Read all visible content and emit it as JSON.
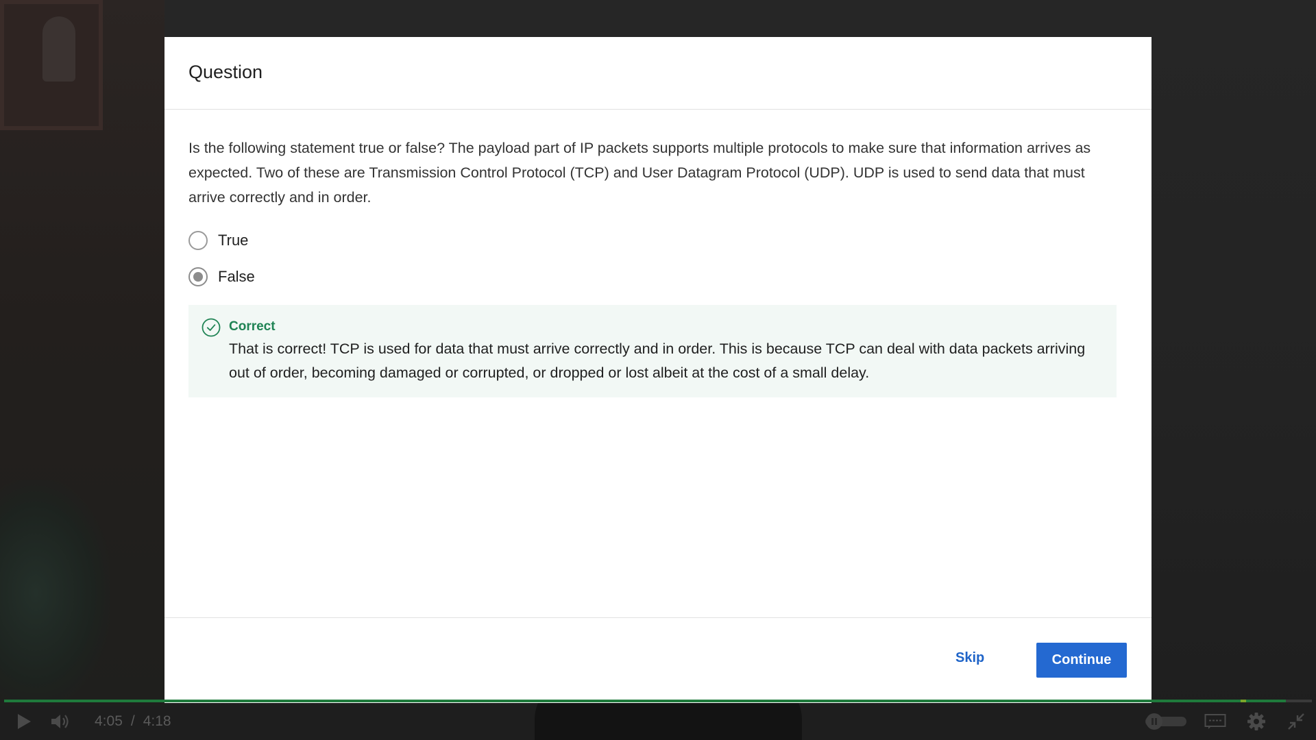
{
  "modal": {
    "title": "Question",
    "question": "Is the following statement true or false? The payload part of IP packets supports multiple protocols to make sure that information arrives as expected. Two of these are Transmission Control Protocol (TCP) and User Datagram Protocol (UDP). UDP is used to send data that must arrive correctly and in order.",
    "options": [
      {
        "label": "True",
        "selected": false
      },
      {
        "label": "False",
        "selected": true
      }
    ],
    "feedback": {
      "title": "Correct",
      "text": "That is correct! TCP is used for data that must arrive correctly and in order. This is because TCP can deal with data packets arriving out of order, becoming damaged or corrupted, or dropped or lost albeit at the cost of a small delay.",
      "icon": "check-circle-icon",
      "color": "#1f8354"
    },
    "footer": {
      "skip_label": "Skip",
      "continue_label": "Continue"
    }
  },
  "player": {
    "current_time": "4:05",
    "separator": "/",
    "duration": "4:18",
    "progress": 0.98,
    "icons": [
      "play-icon",
      "volume-icon",
      "autoplay-toggle-icon",
      "captions-icon",
      "settings-icon",
      "exit-fullscreen-icon"
    ]
  },
  "colors": {
    "accent": "#2469d1",
    "correct": "#1f8354",
    "feedback_bg": "#f2f8f5"
  }
}
